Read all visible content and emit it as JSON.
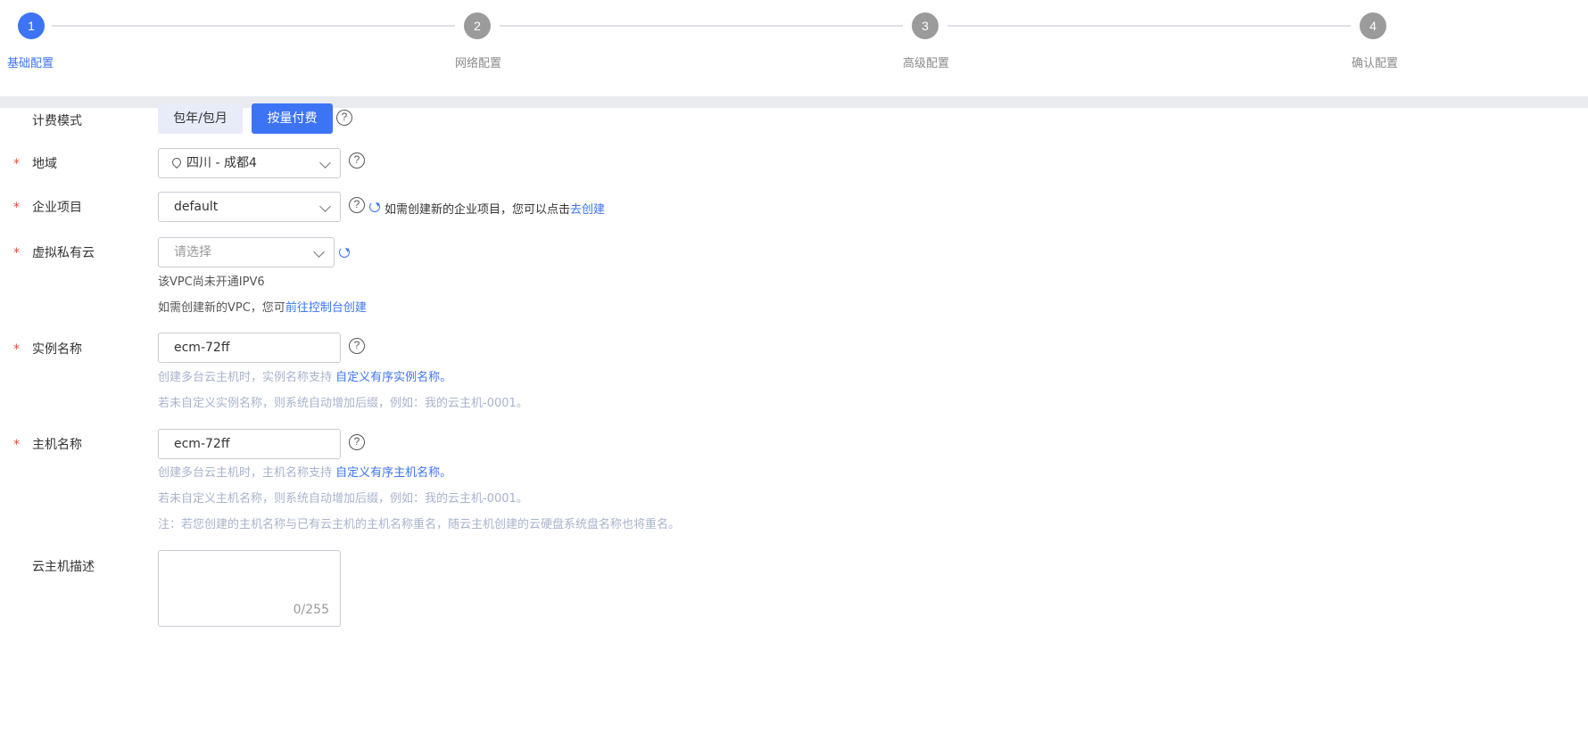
{
  "steps": [
    {
      "num": "1",
      "label": "基础配置",
      "state": "active"
    },
    {
      "num": "2",
      "label": "网络配置",
      "state": "inactive"
    },
    {
      "num": "3",
      "label": "高级配置",
      "state": "inactive"
    },
    {
      "num": "4",
      "label": "确认配置",
      "state": "inactive"
    }
  ],
  "billing": {
    "label": "计费模式",
    "options": [
      "包年/包月",
      "按量付费"
    ],
    "selected": "按量付费"
  },
  "region": {
    "label": "地域",
    "value": "四川 - 成都4"
  },
  "project": {
    "label": "企业项目",
    "value": "default",
    "hint_text": "如需创建新的企业项目，您可以点击",
    "hint_link": "去创建"
  },
  "vpc": {
    "label": "虚拟私有云",
    "placeholder": "请选择",
    "note1": "该VPC尚未开通IPV6",
    "note2_text": "如需创建新的VPC，您可",
    "note2_link": "前往控制台创建"
  },
  "instance_name": {
    "label": "实例名称",
    "value": "ecm-72ff",
    "hint1_text": "创建多台云主机时，实例名称支持 ",
    "hint1_link": "自定义有序实例名称。",
    "hint2": "若未自定义实例名称，则系统自动增加后缀，例如：我的云主机-0001。"
  },
  "host_name": {
    "label": "主机名称",
    "value": "ecm-72ff",
    "hint1_text": "创建多台云主机时，主机名称支持 ",
    "hint1_link": "自定义有序主机名称。",
    "hint2": "若未自定义主机名称，则系统自动增加后缀，例如：我的云主机-0001。",
    "hint3": "注：若您创建的主机名称与已有云主机的主机名称重名，随云主机创建的云硬盘系统盘名称也将重名。"
  },
  "description": {
    "label": "云主机描述",
    "counter": "0/255"
  },
  "required_mark": "*",
  "help_glyph": "?",
  "colors": {
    "accent": "#3d74f5",
    "required": "#e8493c",
    "hint": "#a8b3cc"
  }
}
